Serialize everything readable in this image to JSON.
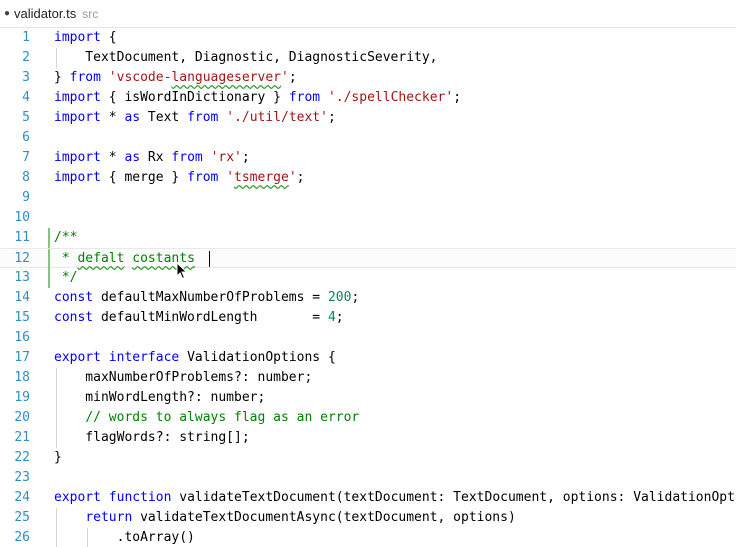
{
  "tab": {
    "dirty_marker": "●",
    "filename": "validator.ts",
    "directory": "src"
  },
  "editor": {
    "line_numbers": [
      "1",
      "2",
      "3",
      "4",
      "5",
      "6",
      "7",
      "8",
      "9",
      "10",
      "11",
      "12",
      "13",
      "14",
      "15",
      "16",
      "17",
      "18",
      "19",
      "20",
      "21",
      "22",
      "23",
      "24",
      "25",
      "26"
    ],
    "current_line": 12,
    "modified_lines": [
      11,
      12,
      13
    ],
    "colors": {
      "keyword": "#0000ff",
      "string": "#a31515",
      "number": "#09885a",
      "comment": "#008000",
      "line_number": "#2f8fc4",
      "spell_squiggle": "#3aa13a"
    },
    "lines": [
      [
        {
          "t": "import",
          "c": "k"
        },
        {
          "t": " {"
        }
      ],
      [
        {
          "t": "    TextDocument, Diagnostic, DiagnosticSeverity,"
        }
      ],
      [
        {
          "t": "} "
        },
        {
          "t": "from",
          "c": "k"
        },
        {
          "t": " "
        },
        {
          "t": "'vscode-",
          "c": "s"
        },
        {
          "t": "languageserver",
          "c": "s",
          "sq": true
        },
        {
          "t": "'",
          "c": "s"
        },
        {
          "t": ";"
        }
      ],
      [
        {
          "t": "import",
          "c": "k"
        },
        {
          "t": " { isWordInDictionary } "
        },
        {
          "t": "from",
          "c": "k"
        },
        {
          "t": " "
        },
        {
          "t": "'./spellChecker'",
          "c": "s"
        },
        {
          "t": ";"
        }
      ],
      [
        {
          "t": "import",
          "c": "k"
        },
        {
          "t": " * "
        },
        {
          "t": "as",
          "c": "k"
        },
        {
          "t": " Text "
        },
        {
          "t": "from",
          "c": "k"
        },
        {
          "t": " "
        },
        {
          "t": "'./util/text'",
          "c": "s"
        },
        {
          "t": ";"
        }
      ],
      [],
      [
        {
          "t": "import",
          "c": "k"
        },
        {
          "t": " * "
        },
        {
          "t": "as",
          "c": "k"
        },
        {
          "t": " Rx "
        },
        {
          "t": "from",
          "c": "k"
        },
        {
          "t": " "
        },
        {
          "t": "'rx'",
          "c": "s"
        },
        {
          "t": ";"
        }
      ],
      [
        {
          "t": "import",
          "c": "k"
        },
        {
          "t": " { merge } "
        },
        {
          "t": "from",
          "c": "k"
        },
        {
          "t": " "
        },
        {
          "t": "'",
          "c": "s"
        },
        {
          "t": "tsmerge",
          "c": "s",
          "sq": true
        },
        {
          "t": "'",
          "c": "s"
        },
        {
          "t": ";"
        }
      ],
      [],
      [],
      [
        {
          "t": "/**",
          "c": "c"
        }
      ],
      [
        {
          "t": " * ",
          "c": "c"
        },
        {
          "t": "defalt",
          "c": "c",
          "sq": true
        },
        {
          "t": " ",
          "c": "c"
        },
        {
          "t": "costants",
          "c": "c",
          "sq": true
        },
        {
          "t": " ",
          "c": "c"
        }
      ],
      [
        {
          "t": " */",
          "c": "c"
        }
      ],
      [
        {
          "t": "const",
          "c": "k"
        },
        {
          "t": " defaultMaxNumberOfProblems = "
        },
        {
          "t": "200",
          "c": "n"
        },
        {
          "t": ";"
        }
      ],
      [
        {
          "t": "const",
          "c": "k"
        },
        {
          "t": " defaultMinWordLength       = "
        },
        {
          "t": "4",
          "c": "n"
        },
        {
          "t": ";"
        }
      ],
      [],
      [
        {
          "t": "export",
          "c": "k"
        },
        {
          "t": " "
        },
        {
          "t": "interface",
          "c": "k"
        },
        {
          "t": " ValidationOptions {"
        }
      ],
      [
        {
          "t": "    maxNumberOfProblems?: number;"
        }
      ],
      [
        {
          "t": "    minWordLength?: number;"
        }
      ],
      [
        {
          "t": "    "
        },
        {
          "t": "// words to always flag as an error",
          "c": "c"
        }
      ],
      [
        {
          "t": "    flagWords?: string[];"
        }
      ],
      [
        {
          "t": "}"
        }
      ],
      [],
      [
        {
          "t": "export",
          "c": "k"
        },
        {
          "t": " "
        },
        {
          "t": "function",
          "c": "k"
        },
        {
          "t": " validateTextDocument(textDocument: TextDocument, options: ValidationOpti"
        }
      ],
      [
        {
          "t": "    "
        },
        {
          "t": "return",
          "c": "k"
        },
        {
          "t": " validateTextDocumentAsync(textDocument, options)"
        }
      ],
      [
        {
          "t": "        .toArray()"
        }
      ]
    ],
    "indent_guides": [
      {
        "line": 2,
        "level": 1
      },
      {
        "line": 18,
        "level": 1
      },
      {
        "line": 19,
        "level": 1
      },
      {
        "line": 20,
        "level": 1
      },
      {
        "line": 21,
        "level": 1
      },
      {
        "line": 25,
        "level": 1
      },
      {
        "line": 26,
        "level": 1
      },
      {
        "line": 26,
        "level": 2
      }
    ]
  }
}
